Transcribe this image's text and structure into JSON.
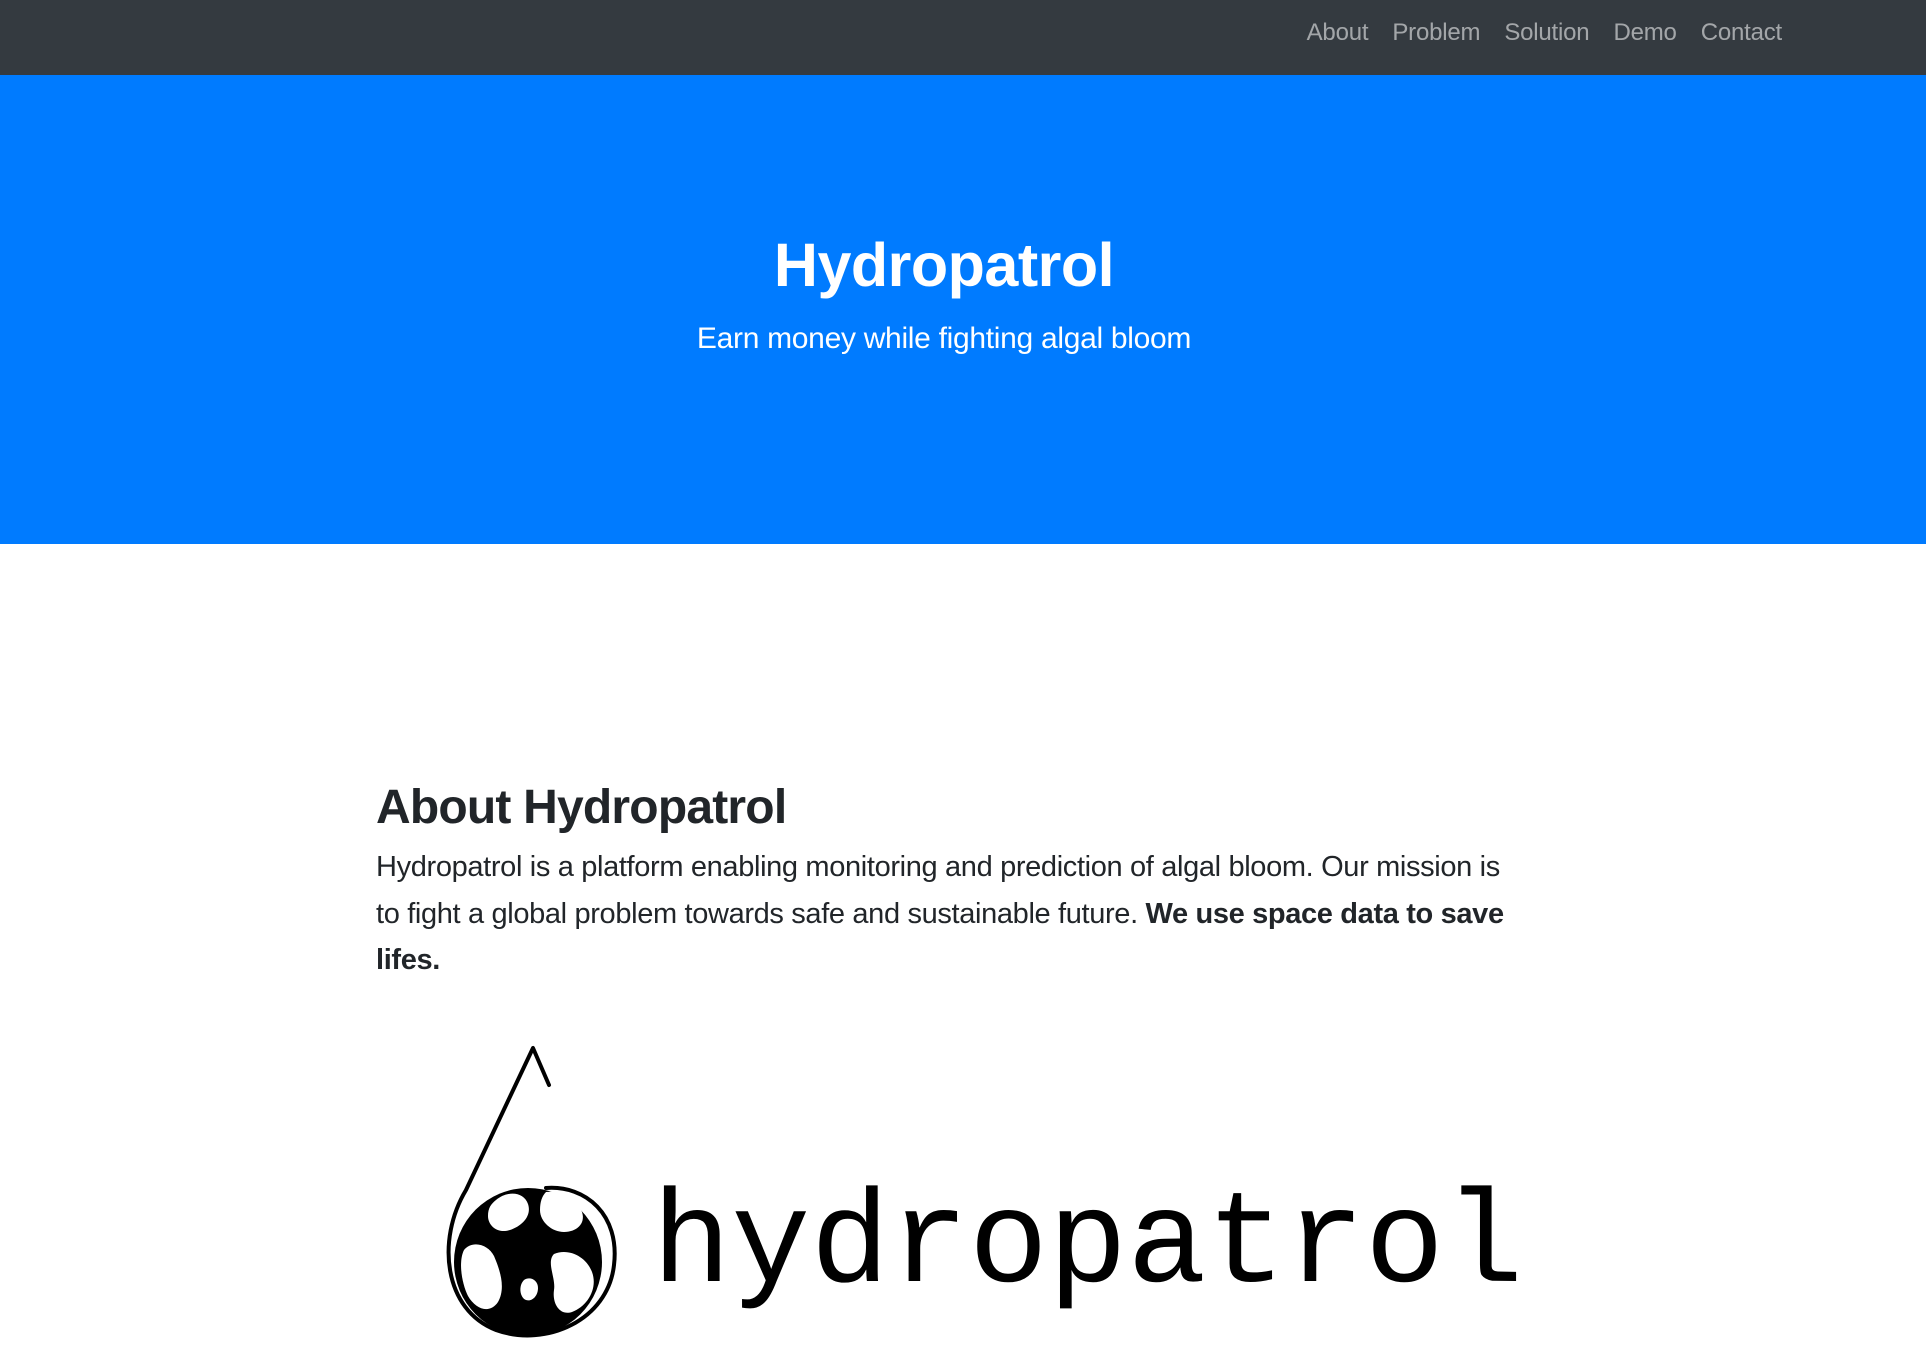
{
  "nav": {
    "items": [
      {
        "label": "About"
      },
      {
        "label": "Problem"
      },
      {
        "label": "Solution"
      },
      {
        "label": "Demo"
      },
      {
        "label": "Contact"
      }
    ]
  },
  "hero": {
    "title": "Hydropatrol",
    "subtitle": "Earn money while fighting algal bloom"
  },
  "about": {
    "heading": "About Hydropatrol",
    "text_plain": "Hydropatrol is a platform enabling monitoring and prediction of algal bloom. Our mission is to fight a global problem towards safe and sustainable future. ",
    "text_bold": "We use space data to save lifes."
  },
  "logo": {
    "wordmark": "hydropatrol",
    "icon": "water-drop-globe-icon"
  },
  "colors": {
    "navbar": "#343a40",
    "hero": "#007bff",
    "text": "#212529"
  }
}
